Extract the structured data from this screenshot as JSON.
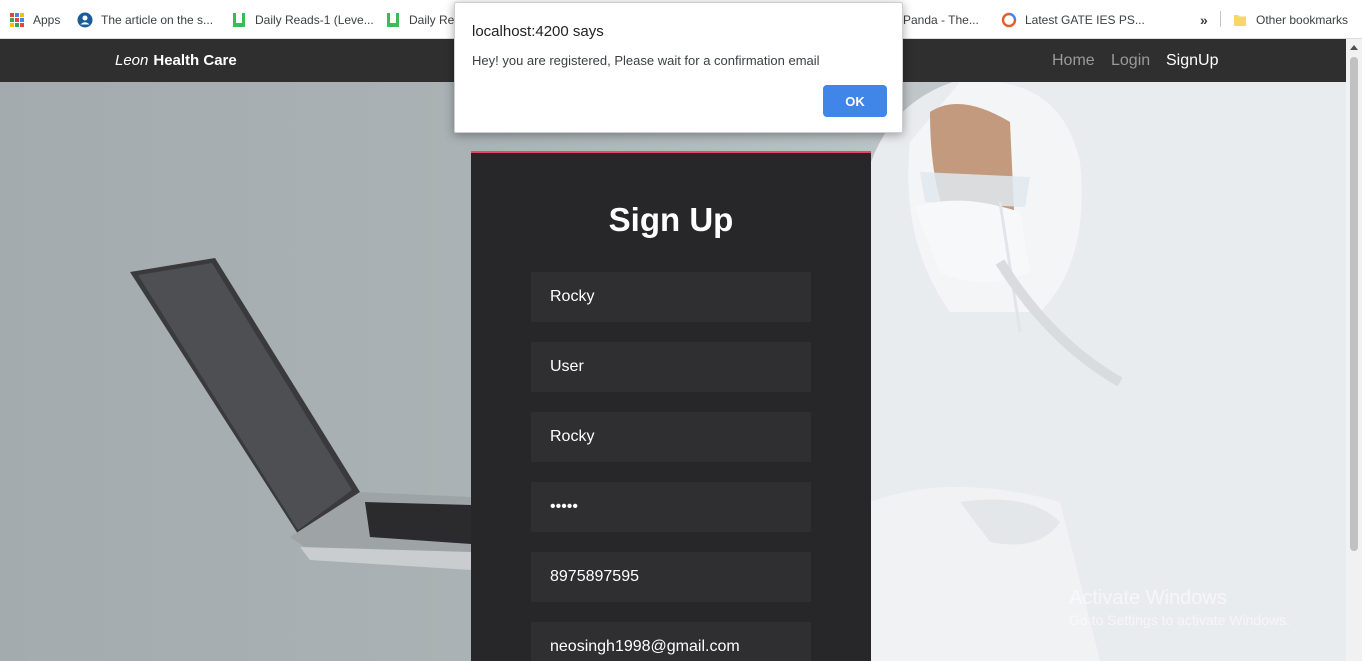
{
  "bookmarks": {
    "apps": "Apps",
    "items": [
      {
        "label": "The article on the s...",
        "icon": "globe-person-icon",
        "color": "#1a5c9a"
      },
      {
        "label": "Daily Reads-1 (Leve...",
        "icon": "bookmark-w-icon",
        "color": "#3cba54"
      },
      {
        "label": "Daily Rea",
        "icon": "bookmark-w-icon",
        "color": "#3cba54"
      },
      {
        "label": "Panda - The...",
        "icon": "none"
      },
      {
        "label": "Latest GATE IES PS...",
        "icon": "refresh-circle-icon",
        "color": "#e65c2e"
      }
    ],
    "other": "Other bookmarks"
  },
  "navbar": {
    "brand_first": "Leon",
    "brand_rest": "Health Care",
    "links": [
      "Home",
      "Login",
      "SignUp"
    ]
  },
  "form": {
    "title": "Sign Up",
    "fields": [
      "Rocky",
      "User",
      "Rocky",
      "•••••",
      "8975897595",
      "neosingh1998@gmail.com"
    ]
  },
  "dialog": {
    "title": "localhost:4200 says",
    "message": "Hey! you are registered, Please wait for a confirmation email",
    "ok": "OK"
  },
  "watermark": {
    "line1": "Activate Windows",
    "line2": "Go to Settings to activate Windows."
  },
  "colors": {
    "navbar": "#2f2f2f",
    "card": "#272629",
    "card_accent": "#e8476a",
    "ok_button": "#3f86e8"
  }
}
